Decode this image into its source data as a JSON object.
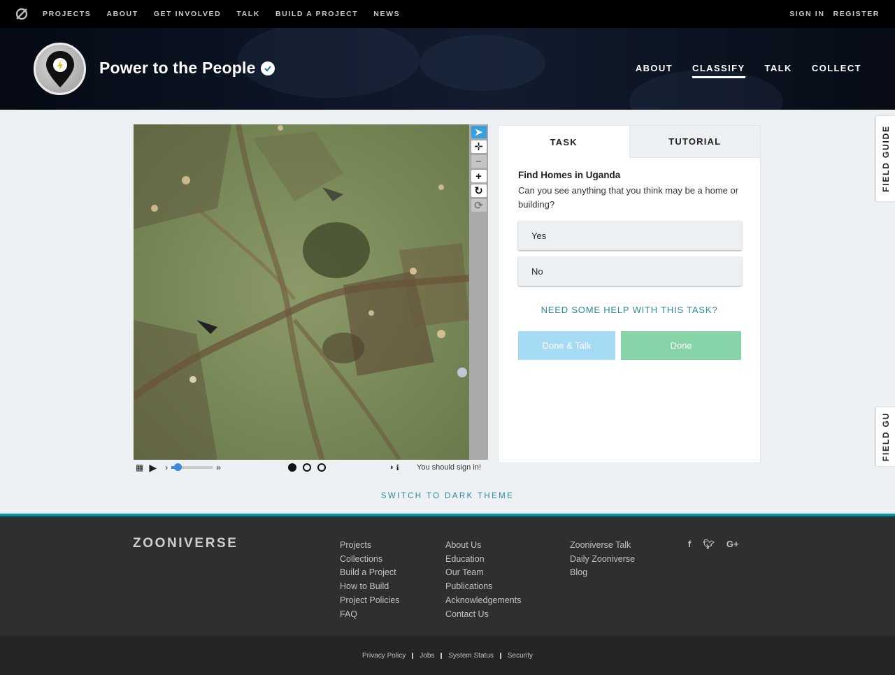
{
  "topnav": {
    "links": [
      "PROJECTS",
      "ABOUT",
      "GET INVOLVED",
      "TALK",
      "BUILD A PROJECT",
      "NEWS"
    ],
    "sign_in": "SIGN IN",
    "register": "REGISTER",
    "logo_icon": "zooniverse-icon"
  },
  "project": {
    "title": "Power to the People",
    "nav": [
      "ABOUT",
      "CLASSIFY",
      "TALK",
      "COLLECT"
    ],
    "active_nav": "CLASSIFY"
  },
  "viewer": {
    "status_text": "You should sign in!",
    "tools": [
      "pointer-icon",
      "move-icon",
      "zoom-out-icon",
      "zoom-in-icon",
      "rotate-icon",
      "reset-icon"
    ]
  },
  "task": {
    "tabs": [
      "TASK",
      "TUTORIAL"
    ],
    "title": "Find Homes in Uganda",
    "question": "Can you see anything that you think may be a home or building?",
    "answers": [
      "Yes",
      "No"
    ],
    "help": "NEED SOME HELP WITH THIS TASK?",
    "done_talk": "Done & Talk",
    "done": "Done"
  },
  "field_guide": {
    "label": "FIELD GUIDE",
    "label_truncated": "FIELD GU"
  },
  "theme_switch": "SWITCH TO DARK THEME",
  "footer": {
    "logo": "ZOONIVERSE",
    "col1": [
      "Projects",
      "Collections",
      "Build a Project",
      "How to Build",
      "Project Policies",
      "FAQ"
    ],
    "col2": [
      "About Us",
      "Education",
      "Our Team",
      "Publications",
      "Acknowledgements",
      "Contact Us"
    ],
    "col3": [
      "Zooniverse Talk",
      "Daily Zooniverse",
      "Blog"
    ],
    "social": [
      "f",
      "twitter-icon",
      "G+"
    ],
    "legal": [
      "Privacy Policy",
      "Jobs",
      "System Status",
      "Security"
    ]
  },
  "colors": {
    "accent": "#00979d",
    "done_talk": "#a6dbf6",
    "done": "#88d4a9",
    "tool_active": "#3aa0dc"
  }
}
